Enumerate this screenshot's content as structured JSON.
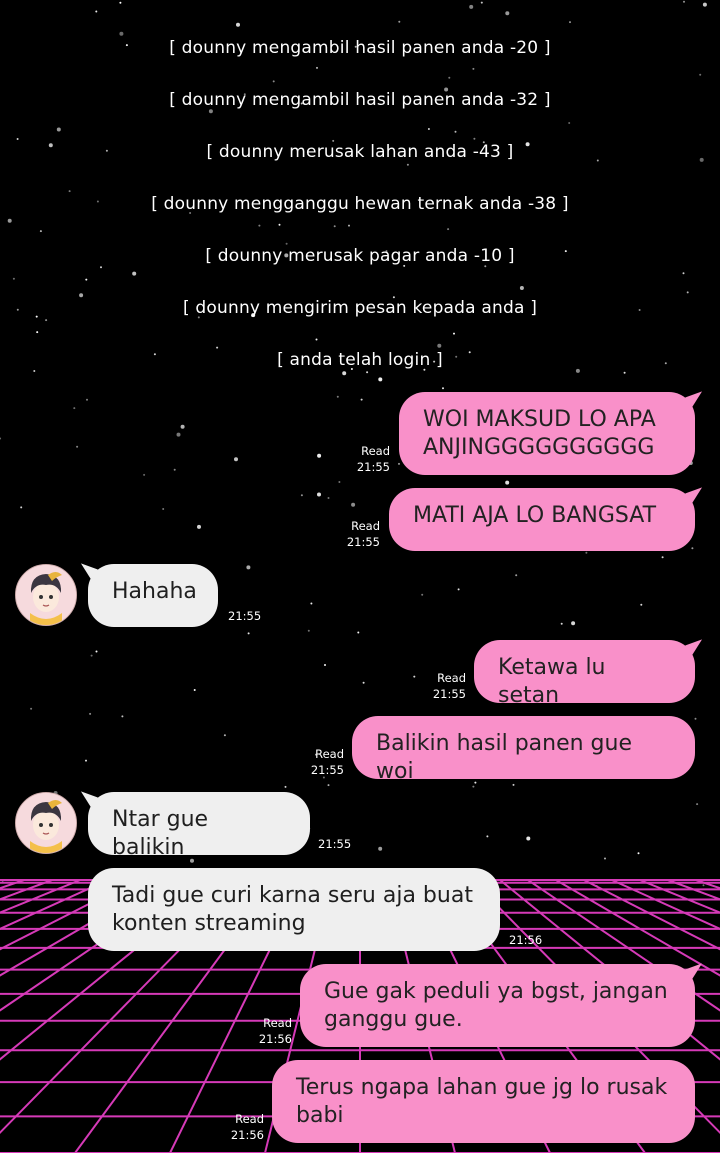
{
  "system_messages": [
    "[ dounny mengambil hasil panen anda -20 ]",
    "[ dounny mengambil hasil panen anda -32 ]",
    "[ dounny merusak lahan anda -43 ]",
    "[ dounny mengganggu hewan ternak anda -38 ]",
    "[ dounny merusak pagar anda -10 ]",
    "[ dounny mengirim pesan kepada anda ]",
    "[ anda telah login ]"
  ],
  "messages": [
    {
      "dir": "out",
      "text": "WOI MAKSUD LO APA\nANJINGGGGGGGGGG",
      "read": "Read",
      "time": "21:55"
    },
    {
      "dir": "out",
      "text": "MATI AJA LO BANGSAT",
      "read": "Read",
      "time": "21:55"
    },
    {
      "dir": "in",
      "text": "Hahaha",
      "time": "21:55"
    },
    {
      "dir": "out",
      "text": "Ketawa lu setan",
      "read": "Read",
      "time": "21:55"
    },
    {
      "dir": "out",
      "text": "Balikin hasil panen gue woi",
      "read": "Read",
      "time": "21:55"
    },
    {
      "dir": "in",
      "text": "Ntar gue balikin",
      "time": "21:55"
    },
    {
      "dir": "in",
      "text": "Tadi gue curi karna seru aja buat\nkonten streaming",
      "time": "21:56"
    },
    {
      "dir": "out",
      "text": "Gue gak peduli ya bgst, jangan\nganggu gue.",
      "read": "Read",
      "time": "21:56"
    },
    {
      "dir": "out",
      "text": "Terus ngapa lahan gue jg lo rusak\nbabi",
      "read": "Read",
      "time": "21:56"
    }
  ],
  "colors": {
    "outgoing_bubble": "#f990c9",
    "incoming_bubble": "#efefef",
    "background": "#000000",
    "grid": "#d63ab8"
  },
  "icons": {
    "contact_avatar": "anime-character-avatar-icon"
  }
}
